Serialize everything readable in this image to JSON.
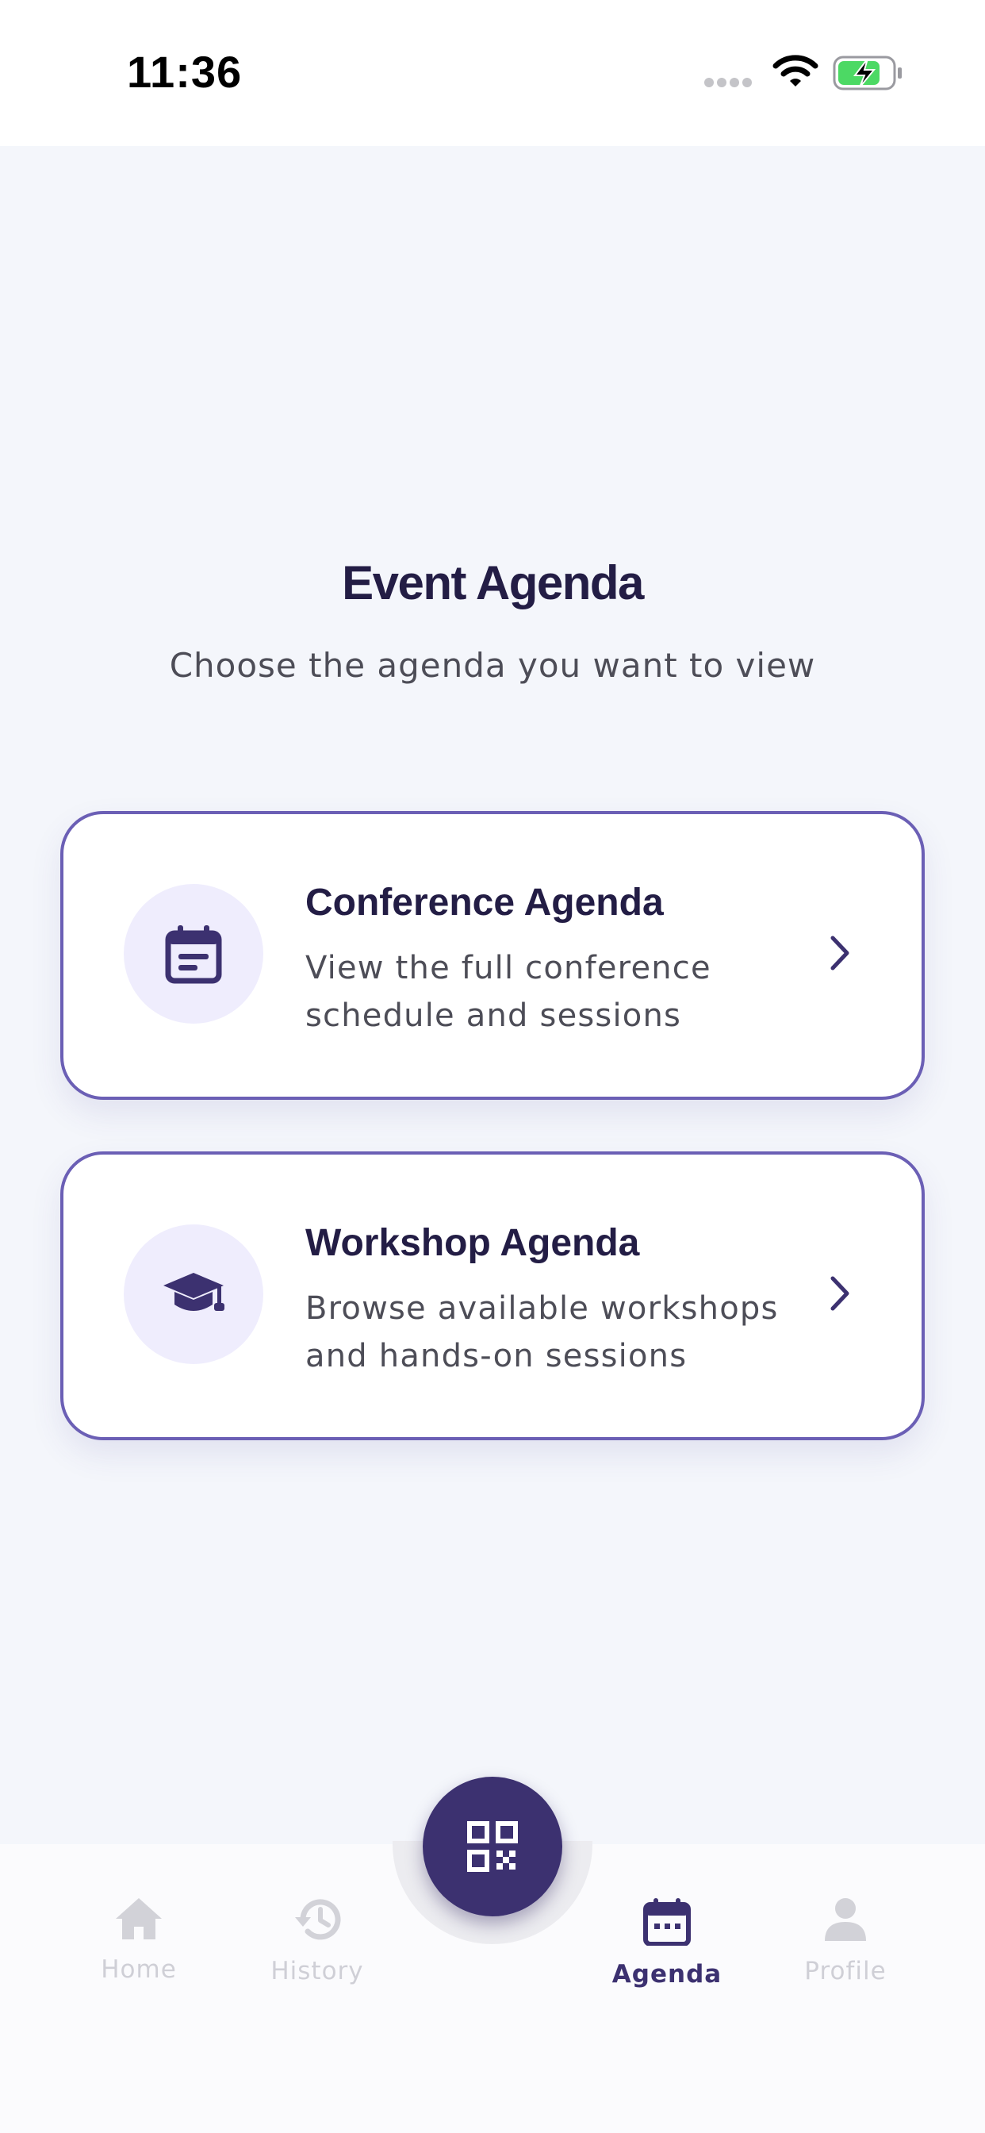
{
  "status_bar": {
    "time": "11:36"
  },
  "header": {
    "title": "Event Agenda",
    "subtitle": "Choose the agenda you want to view"
  },
  "cards": [
    {
      "title": "Conference Agenda",
      "description": "View the full conference schedule and sessions",
      "icon": "calendar-icon"
    },
    {
      "title": "Workshop Agenda",
      "description": "Browse available workshops and hands-on sessions",
      "icon": "graduation-cap-icon"
    }
  ],
  "tabbar": {
    "home_label": "Home",
    "history_label": "History",
    "agenda_label": "Agenda",
    "profile_label": "Profile",
    "active_tab": "Agenda",
    "fab_icon": "qr-code-icon"
  },
  "colors": {
    "accent": "#3c3170",
    "card_border": "#6b5fb5",
    "icon_bg": "#efedfd",
    "title": "#231d45",
    "background": "#f4f6fb",
    "inactive_tab": "#cfcfd6",
    "battery_green": "#4cd964"
  }
}
